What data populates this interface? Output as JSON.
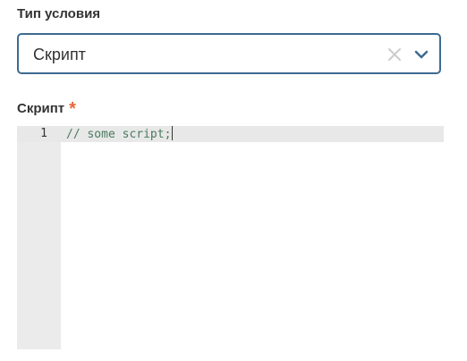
{
  "condition_type": {
    "label": "Тип условия",
    "selected_value": "Скрипт",
    "clear_icon": "close-icon",
    "toggle_icon": "chevron-down-icon",
    "accent_color": "#3d6a91"
  },
  "script_field": {
    "label": "Скрипт",
    "required_marker": "*",
    "required_color": "#e8663a",
    "editor": {
      "lines": [
        {
          "number": "1",
          "text": "// some script;"
        }
      ],
      "comment_color": "#4a7a5e"
    }
  }
}
